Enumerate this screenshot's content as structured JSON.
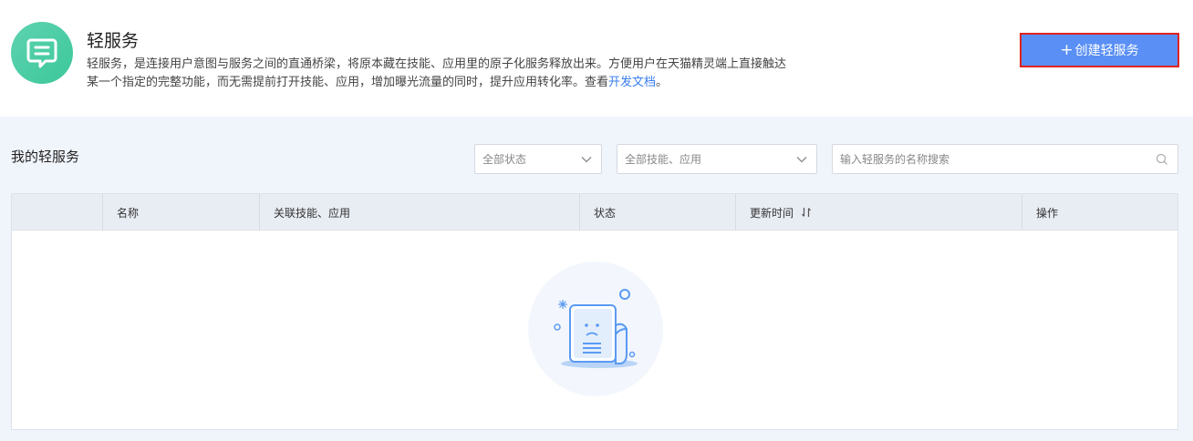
{
  "header": {
    "title": "轻服务",
    "desc_line1": "轻服务，是连接用户意图与服务之间的直通桥梁，将原本藏在技能、应用里的原子化服务释放出来。方便用户在天猫精灵端上直接触达",
    "desc_line2_pre": "某一个指定的完整功能，而无需提前打开技能、应用，增加曝光流量的同时，提升应用转化率。查看",
    "desc_link": "开发文档",
    "desc_line2_post": "。",
    "create_button": "创建轻服务",
    "create_icon": "plus-icon"
  },
  "toolbar": {
    "section_title": "我的轻服务",
    "status_select": "全部状态",
    "skill_select": "全部技能、应用",
    "search_placeholder": "输入轻服务的名称搜索"
  },
  "table": {
    "columns": [
      "",
      "名称",
      "关联技能、应用",
      "状态",
      "更新时间",
      "操作"
    ],
    "rows": []
  },
  "colors": {
    "primary": "#5a8ff5",
    "link": "#3a7ef0",
    "logo": "#3cc79a",
    "highlight_border": "#e0231f"
  }
}
